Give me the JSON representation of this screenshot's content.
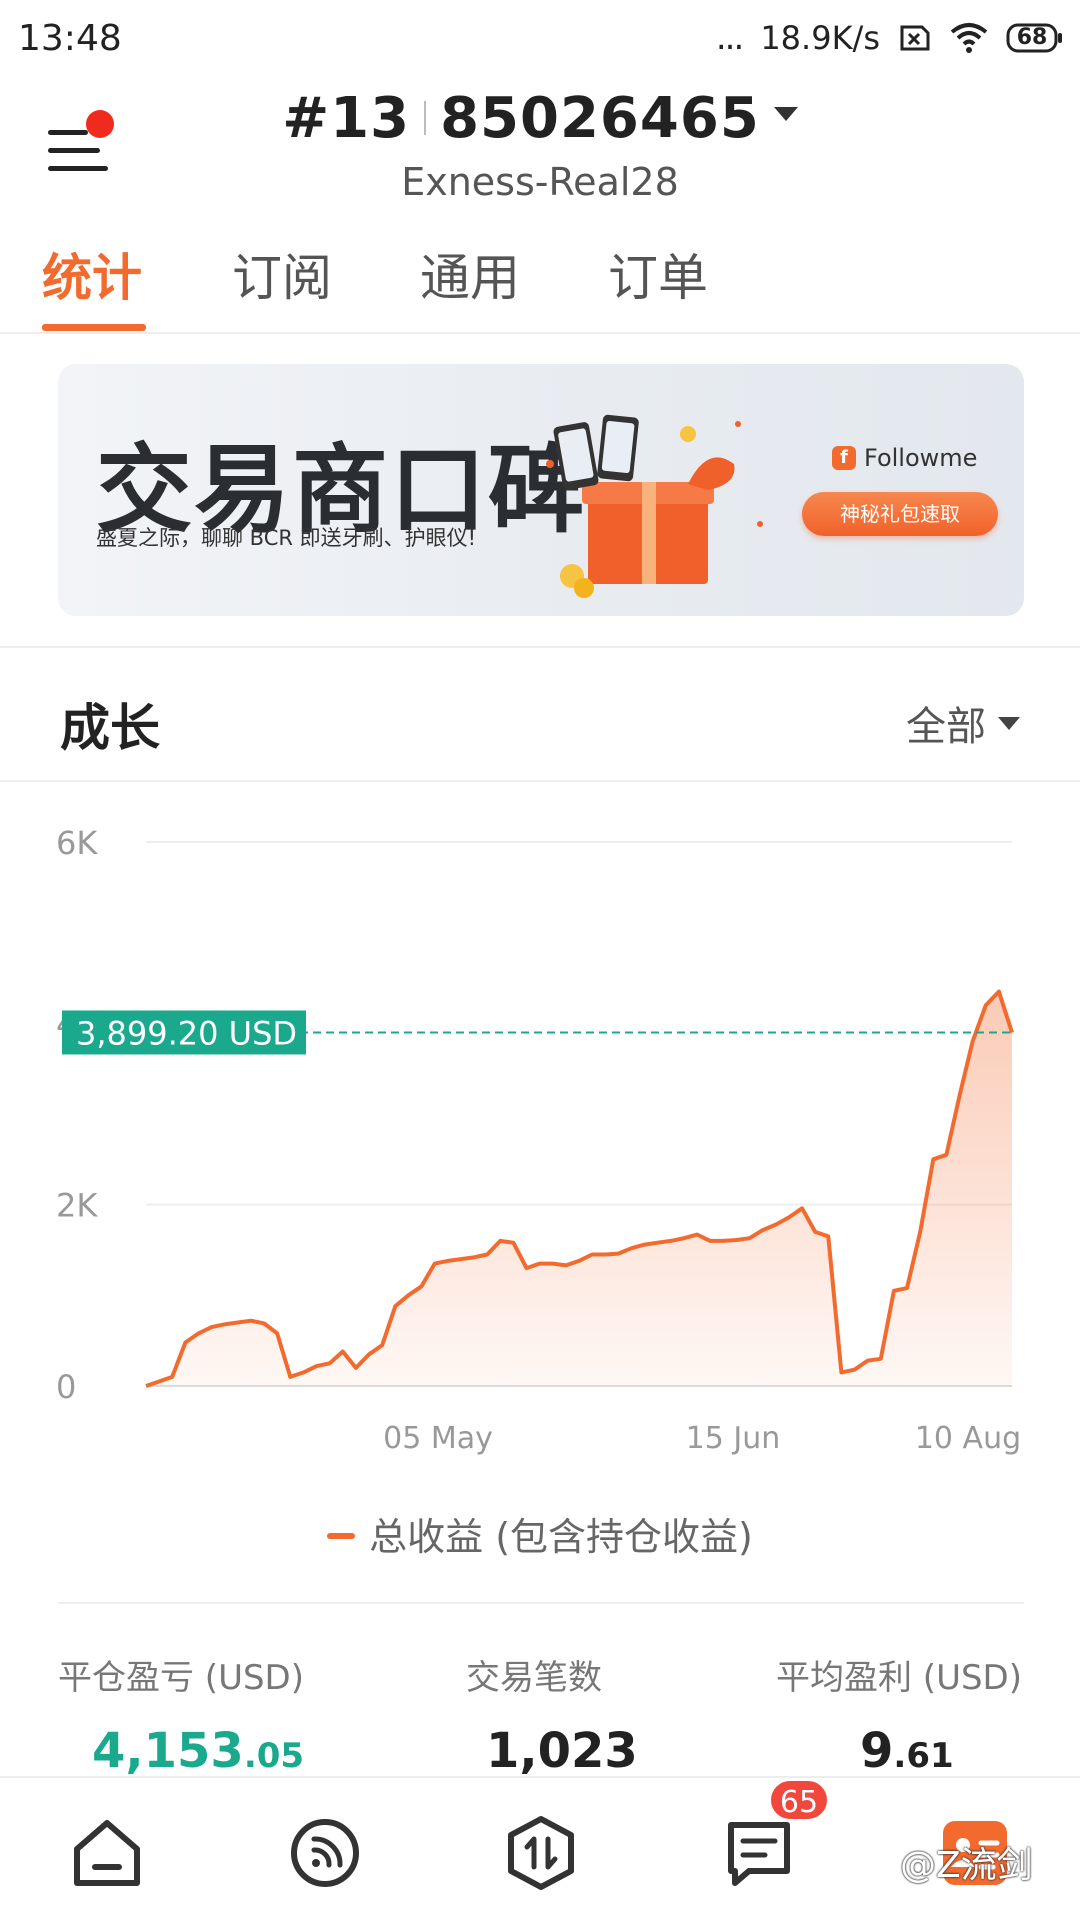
{
  "status_bar": {
    "time": "13:48",
    "dots": "...",
    "network_speed": "18.9K/s",
    "battery": "68"
  },
  "header": {
    "account_prefix": "#13",
    "account_number": "85026465",
    "server": "Exness-Real28"
  },
  "tabs": [
    {
      "label": "统计",
      "active": true
    },
    {
      "label": "订阅",
      "active": false
    },
    {
      "label": "通用",
      "active": false
    },
    {
      "label": "订单",
      "active": false
    }
  ],
  "banner": {
    "title": "交易商口碑",
    "subtitle": "盛夏之际，聊聊 BCR 即送牙刷、护眼仪!",
    "brand": "Followme",
    "brand_logo": "f",
    "cta": "神秘礼包速取"
  },
  "growth": {
    "title": "成长",
    "range": "全部"
  },
  "chart_data": {
    "type": "area",
    "y_ticks": [
      "6K",
      "4K",
      "2K",
      "0"
    ],
    "ylim": [
      0,
      6000
    ],
    "x_ticks": [
      "05 May",
      "15 Jun",
      "10 Aug"
    ],
    "current_value_label": "3,899.20 USD",
    "current_value": 3899.2,
    "series": [
      {
        "name": "总收益 (包含持仓收益)",
        "color": "#f26a2e",
        "values": [
          0,
          50,
          100,
          480,
          580,
          650,
          680,
          700,
          720,
          690,
          580,
          100,
          150,
          220,
          250,
          380,
          200,
          350,
          450,
          880,
          1000,
          1100,
          1350,
          1380,
          1400,
          1420,
          1450,
          1600,
          1580,
          1300,
          1350,
          1350,
          1330,
          1380,
          1450,
          1450,
          1460,
          1520,
          1560,
          1580,
          1600,
          1630,
          1670,
          1600,
          1600,
          1610,
          1630,
          1720,
          1780,
          1860,
          1960,
          1700,
          1650,
          150,
          180,
          280,
          300,
          1050,
          1080,
          1700,
          2500,
          2550,
          3200,
          3800,
          4200,
          4350,
          3899
        ]
      }
    ]
  },
  "legend": {
    "label": "总收益 (包含持仓收益)"
  },
  "stats": [
    {
      "label": "平仓盈亏 (USD)",
      "int": "4,153",
      "dec": ".05"
    },
    {
      "label": "交易笔数",
      "int": "1,023",
      "dec": ""
    },
    {
      "label": "平均盈利 (USD)",
      "int": "9",
      "dec": ".61"
    }
  ],
  "bottom_nav": {
    "icons": [
      "home-icon",
      "feed-icon",
      "trade-icon",
      "message-icon",
      "profile-icon"
    ],
    "message_badge": "65"
  },
  "watermark": "@Z流剑"
}
